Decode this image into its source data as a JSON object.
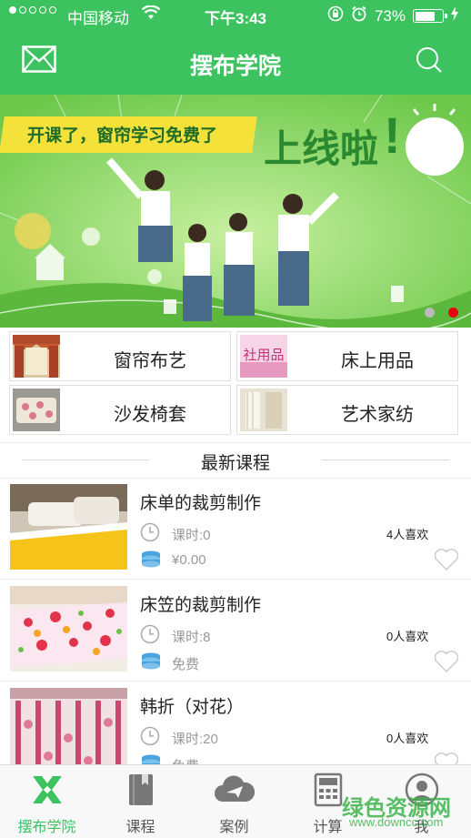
{
  "status_bar": {
    "carrier": "中国移动",
    "time": "下午3:43",
    "battery": "73%",
    "battery_level": 0.73
  },
  "header": {
    "title": "摆布学院"
  },
  "banner": {
    "slogan": "开课了，窗帘学习免费了",
    "headline": "上线啦",
    "exclaim": "!",
    "slide_count": 2,
    "active_slide": 2
  },
  "categories": [
    {
      "label": "窗帘布艺",
      "thumb_text": ""
    },
    {
      "label": "床上用品",
      "thumb_text": "社用品"
    },
    {
      "label": "沙发椅套",
      "thumb_text": ""
    },
    {
      "label": "艺术家纺",
      "thumb_text": ""
    }
  ],
  "section": {
    "title": "最新课程"
  },
  "courses": [
    {
      "title": "床单的裁剪制作",
      "hours": "课时:0",
      "likes": "4人喜欢",
      "price": "¥0.00"
    },
    {
      "title": "床笠的裁剪制作",
      "hours": "课时:8",
      "likes": "0人喜欢",
      "price": "免费"
    },
    {
      "title": "韩折（对花）",
      "hours": "课时:20",
      "likes": "0人喜欢",
      "price": "免费"
    }
  ],
  "tabs": [
    {
      "label": "摆布学院",
      "icon": "academy-icon",
      "active": true
    },
    {
      "label": "课程",
      "icon": "book-icon",
      "active": false
    },
    {
      "label": "案例",
      "icon": "cloud-plane-icon",
      "active": false
    },
    {
      "label": "计算",
      "icon": "calculator-icon",
      "active": false
    },
    {
      "label": "我",
      "icon": "user-icon",
      "active": false
    }
  ],
  "watermark": {
    "text": "绿色资源网",
    "url_text": "www.downcc.com"
  },
  "colors": {
    "brand_green": "#3cc35f",
    "active_dot": "#e60012"
  }
}
